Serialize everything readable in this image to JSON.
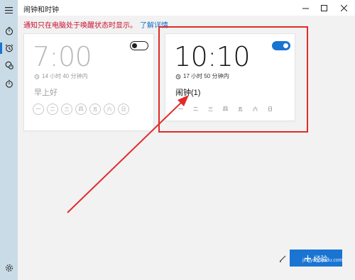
{
  "app": {
    "title": "闹钟和时钟"
  },
  "sidebar": {
    "items": [
      {
        "icon": "hamburger-icon"
      },
      {
        "icon": "timer-icon"
      },
      {
        "icon": "alarm-icon",
        "active": true
      },
      {
        "icon": "world-clock-icon"
      },
      {
        "icon": "stopwatch-icon"
      },
      {
        "icon": "settings-icon"
      }
    ]
  },
  "notice": {
    "text": "通知只在电脑处于唤醒状态时显示。",
    "link": "了解详情"
  },
  "alarms": [
    {
      "time": "7:00",
      "remaining": "14 小时 40 分钟内",
      "name": "早上好",
      "enabled": false,
      "days": [
        "一",
        "二",
        "三",
        "四",
        "五",
        "六",
        "日"
      ]
    },
    {
      "time": "10:10",
      "remaining": "17 小时 50 分钟内",
      "name": "闹钟(1)",
      "enabled": true,
      "days": [
        "一",
        "二",
        "三",
        "四",
        "五",
        "六",
        "日"
      ]
    }
  ],
  "footer": {
    "add_label": "经验",
    "watermark_sub": "jingyan.baidu.com",
    "watermark": "Bai 经验"
  },
  "colors": {
    "accent": "#1a74d2",
    "annotation": "#e02b2b",
    "notice": "#c8102e"
  }
}
